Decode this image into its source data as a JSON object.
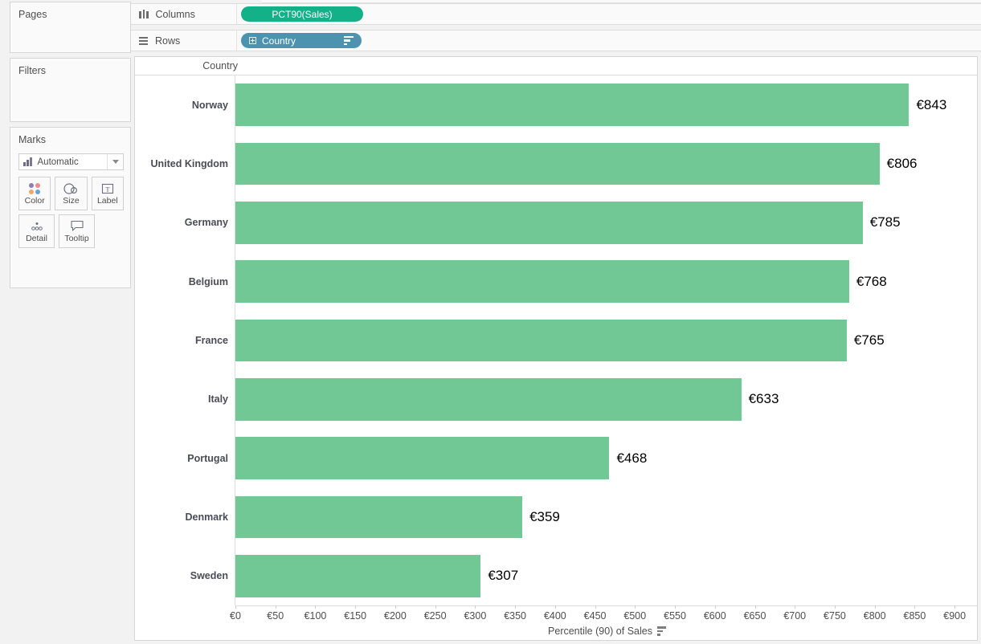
{
  "app": {
    "left_panel": {
      "pages": {
        "title": "Pages"
      },
      "filters": {
        "title": "Filters"
      },
      "marks": {
        "title": "Marks",
        "mark_type": "Automatic",
        "buttons": [
          {
            "label": "Color",
            "icon": "color-dots-icon"
          },
          {
            "label": "Size",
            "icon": "size-circles-icon"
          },
          {
            "label": "Label",
            "icon": "label-text-icon"
          },
          {
            "label": "Detail",
            "icon": "detail-dots-icon"
          },
          {
            "label": "Tooltip",
            "icon": "tooltip-bubble-icon"
          }
        ]
      }
    },
    "shelves": {
      "columns": {
        "label": "Columns",
        "icon": "columns-icon",
        "pill": {
          "text": "PCT90(Sales)",
          "color": "#13b187",
          "type": "measure"
        }
      },
      "rows": {
        "label": "Rows",
        "icon": "rows-icon",
        "pill": {
          "text": "Country",
          "color": "#4d92ae",
          "type": "dimension",
          "sorted": true
        }
      }
    },
    "colors": {
      "bar": "#72c894",
      "measure_pill": "#13b187",
      "dimension_pill": "#4d92ae",
      "panel_background": "#ffffff",
      "app_background": "#f2f2f2"
    }
  },
  "chart_data": {
    "type": "bar",
    "orientation": "horizontal",
    "title": "",
    "row_header": "Country",
    "xlabel": "Percentile (90) of Sales",
    "ylabel": "Country",
    "xlim": [
      0,
      930
    ],
    "x_ticks": [
      0,
      50,
      100,
      150,
      200,
      250,
      300,
      350,
      400,
      450,
      500,
      550,
      600,
      650,
      700,
      750,
      800,
      850,
      900
    ],
    "x_tick_labels": [
      "€0",
      "€50",
      "€100",
      "€150",
      "€200",
      "€250",
      "€300",
      "€350",
      "€400",
      "€450",
      "€500",
      "€550",
      "€600",
      "€650",
      "€700",
      "€750",
      "€800",
      "€850",
      "€900"
    ],
    "grid": false,
    "legend": null,
    "currency_symbol": "€",
    "categories": [
      "Norway",
      "United Kingdom",
      "Germany",
      "Belgium",
      "France",
      "Italy",
      "Portugal",
      "Denmark",
      "Sweden"
    ],
    "values": [
      843,
      806,
      785,
      768,
      765,
      633,
      468,
      359,
      307
    ],
    "data_labels": [
      "€843",
      "€806",
      "€785",
      "€768",
      "€765",
      "€633",
      "€468",
      "€359",
      "€307"
    ],
    "series": [
      {
        "name": "Percentile (90) of Sales",
        "color": "#72c894",
        "values": [
          843,
          806,
          785,
          768,
          765,
          633,
          468,
          359,
          307
        ]
      }
    ]
  }
}
